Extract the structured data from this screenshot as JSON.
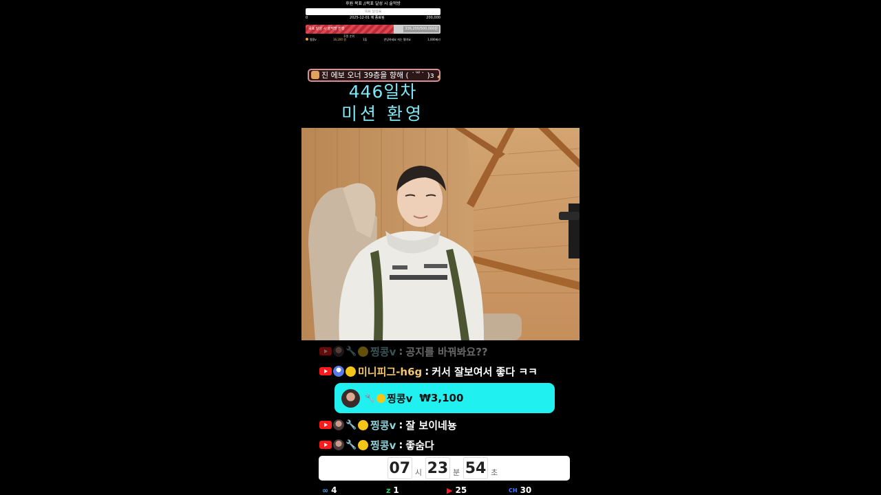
{
  "goal": {
    "title": "후원 목표 //목표 달성 시 술먹방",
    "bar_text": "목표 달성률",
    "scale_min": "0",
    "scale_end_date": "2025-12-01 에 종료됨",
    "scale_max": "200,000",
    "progress_label": "목표 달성 시 술먹방 진행",
    "progress_value": "336,200/500,000원",
    "progress_fraction": 0.67,
    "sub_label": "후원 순위",
    "footer_name": "찡콩v",
    "footer_amount": "16,200 원",
    "footer_rank": "1등",
    "footer_note": "안녕하세요 저는 찡야요",
    "footer_right": "1,000찌리"
  },
  "banner": {
    "icon": "cat-face-icon",
    "text": "진 에보 오너 39층을 향해 ( ˙꒳˙ )з ",
    "spark": "✨"
  },
  "day_count": "446일차",
  "mission": "미션 환영",
  "chat": [
    {
      "platform": "youtube-icon",
      "avatar": "photo",
      "nick": "찡콩v",
      "sep": ":",
      "message": "공지를 바꿔봐요??",
      "faded": true
    },
    {
      "platform": "youtube-icon",
      "avatar": "default",
      "nick": "미니피그-h6g",
      "sep": ":",
      "message": "커서 잘보여서 좋다 ㅋㅋ",
      "faded": false
    },
    {
      "platform": "youtube-icon",
      "avatar": "photo",
      "nick": "찡콩v",
      "sep": ":",
      "message": "잘 보이네뇽",
      "faded": false
    },
    {
      "platform": "youtube-icon",
      "avatar": "photo",
      "nick": "찡콩v",
      "sep": ":",
      "message": "좋숨다",
      "faded": false
    }
  ],
  "donation": {
    "nick": "찡콩v",
    "amount": "₩3,100"
  },
  "timer": {
    "hours": "07",
    "hours_unit": "시",
    "minutes": "23",
    "minutes_unit": "분",
    "seconds": "54",
    "seconds_unit": "초"
  },
  "stats": [
    {
      "icon": "infinity-icon",
      "glyph": "∞",
      "color": "#3fa9f5",
      "value": "4"
    },
    {
      "icon": "zigzag-icon",
      "glyph": "z",
      "color": "#2ecc71",
      "value": "1"
    },
    {
      "icon": "youtube-icon",
      "glyph": "▶",
      "color": "#ff1b1b",
      "value": "25"
    },
    {
      "icon": "chzzk-icon",
      "glyph": "CH",
      "color": "#4a7cff",
      "value": "30"
    }
  ]
}
